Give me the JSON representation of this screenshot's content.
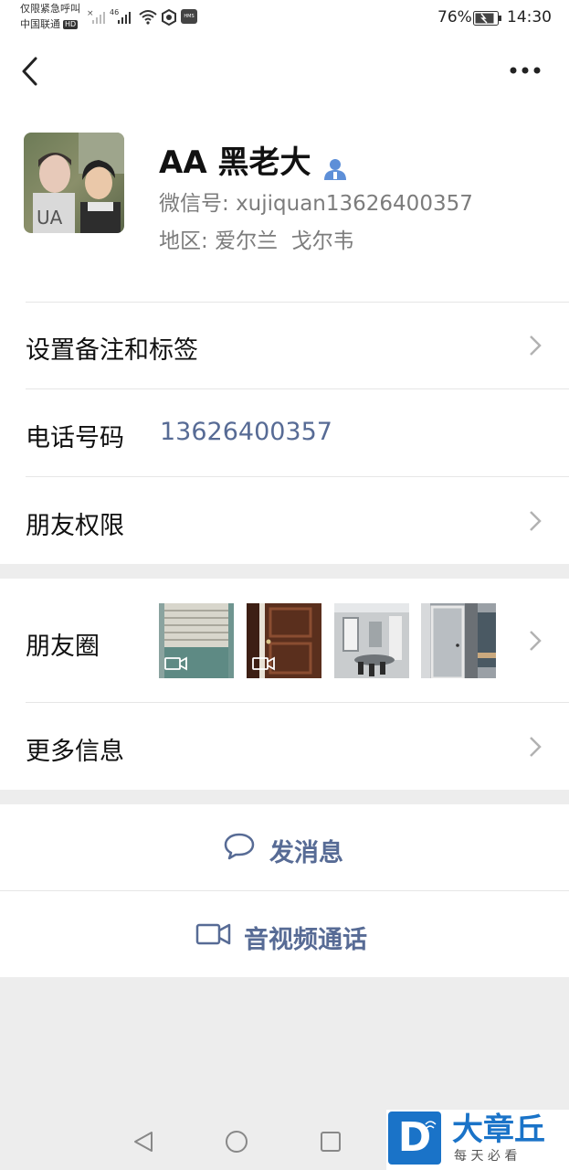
{
  "status_bar": {
    "emergency_text": "仅限紧急呼叫",
    "carrier": "中国联通",
    "hd_label": "HD",
    "network_label": "46",
    "hms_label": "HMS",
    "battery_percent": "76%",
    "time": "14:30"
  },
  "profile": {
    "name": "AA 黑老大",
    "wechat_id_label": "微信号:",
    "wechat_id": "xujiquan13626400357",
    "region_label": "地区:",
    "region": "爱尔兰  戈尔韦"
  },
  "rows": {
    "remark_tags": "设置备注和标签",
    "phone_label": "电话号码",
    "phone_value": "13626400357",
    "permissions": "朋友权限",
    "moments": "朋友圈",
    "more_info": "更多信息"
  },
  "moments_thumbs": [
    {
      "name": "blinds-video",
      "video": true
    },
    {
      "name": "wooden-door-video",
      "video": true
    },
    {
      "name": "meeting-room",
      "video": false
    },
    {
      "name": "grey-door",
      "video": false
    }
  ],
  "actions": {
    "send_message": "发消息",
    "video_call": "音视频通话"
  },
  "watermark": {
    "logo_letter": "D",
    "title": "大章丘",
    "subtitle": "每 天 必 看"
  },
  "colors": {
    "link_blue": "#576b95",
    "verified_blue": "#5d8fd8",
    "page_bg": "#ededed"
  }
}
